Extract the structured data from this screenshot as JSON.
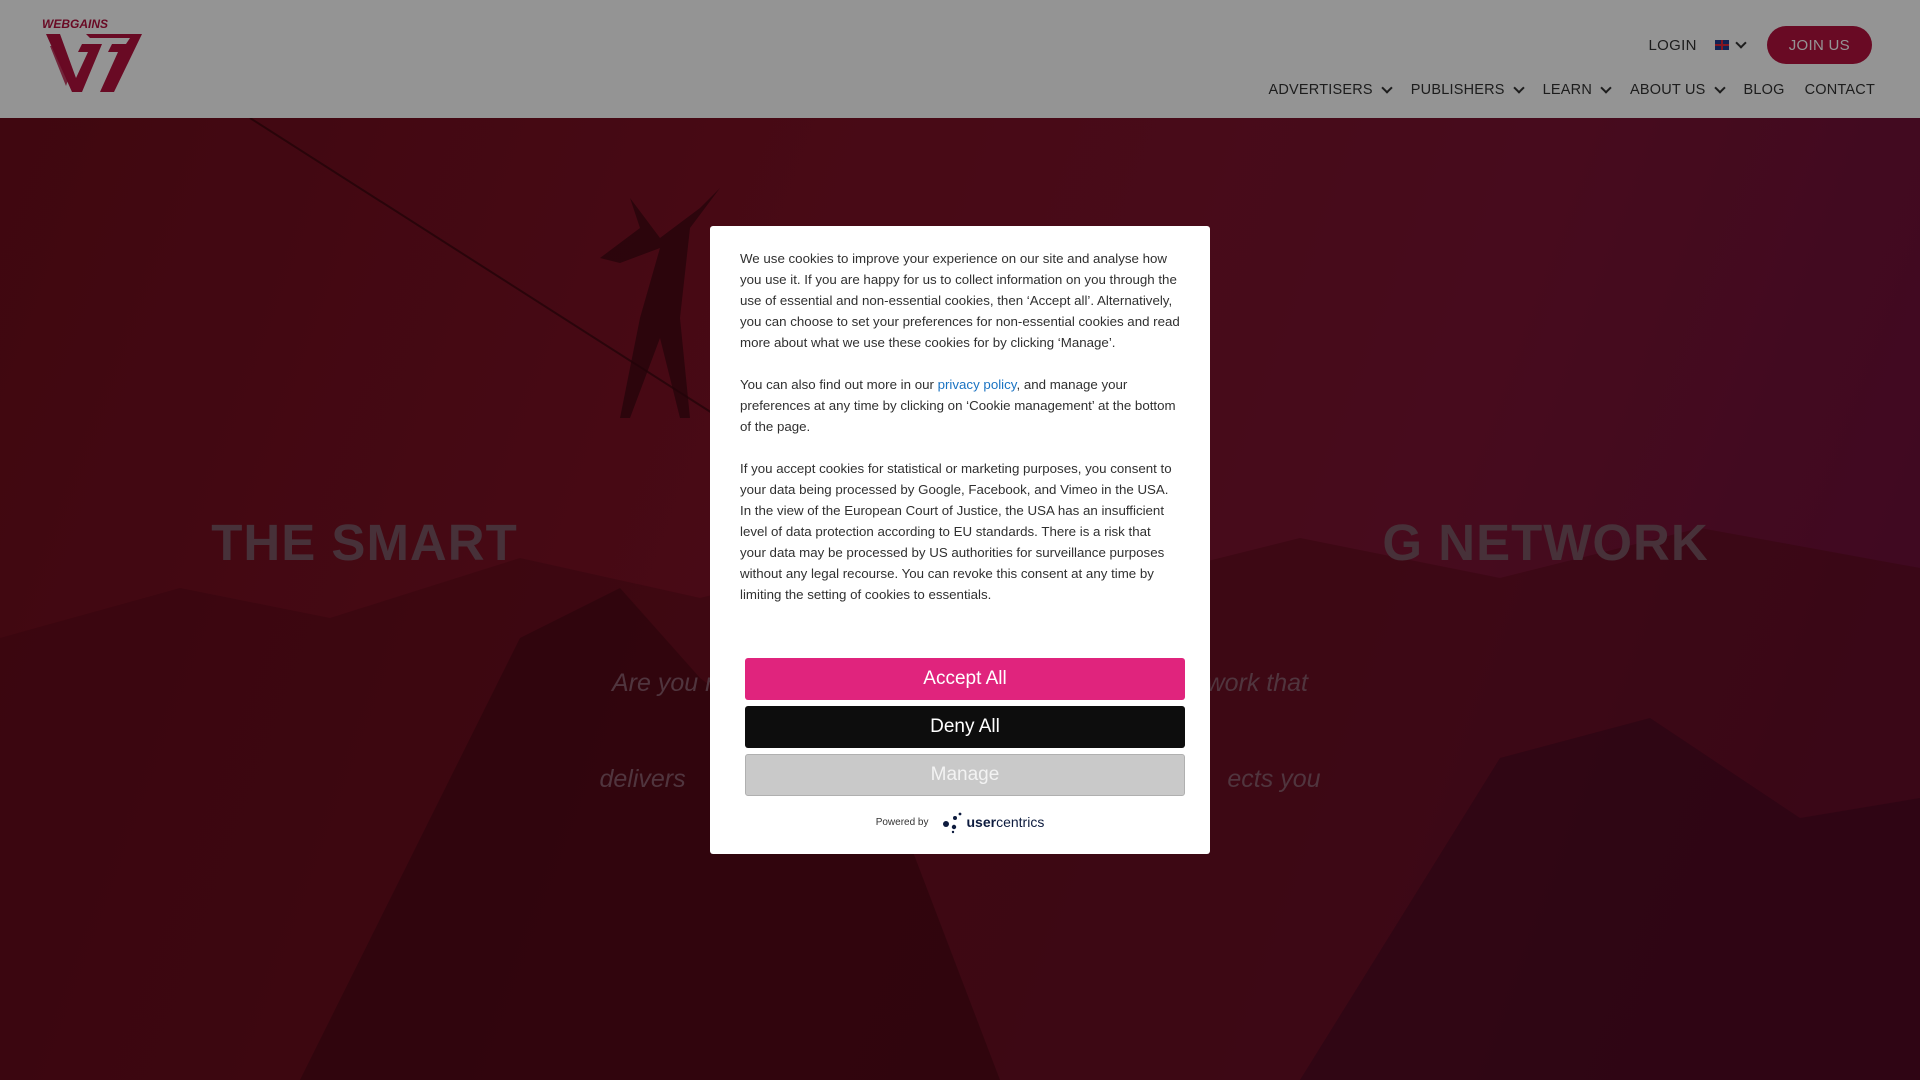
{
  "header": {
    "logo_text": "WEBGAINS",
    "login": "LOGIN",
    "join_button": "JOIN US",
    "nav": [
      {
        "label": "ADVERTISERS",
        "dropdown": true
      },
      {
        "label": "PUBLISHERS",
        "dropdown": true
      },
      {
        "label": "LEARN",
        "dropdown": true
      },
      {
        "label": "ABOUT US",
        "dropdown": true
      },
      {
        "label": "BLOG",
        "dropdown": false
      },
      {
        "label": "CONTACT",
        "dropdown": false
      }
    ]
  },
  "hero": {
    "title": "THE SMART                                                         G NETWORK",
    "subtitle_line1": "Are you r                                                                       work that",
    "subtitle_line2": "delivers                                                                              ects you"
  },
  "consent": {
    "para1": "We use cookies to improve your experience on our site and analyse how you use it. If you are happy for us to collect information on you through the use of essential and non-essential cookies, then ‘Accept all’. Alternatively, you can choose to set your preferences for non-essential cookies and read more about what we use these cookies for by clicking ‘Manage’.",
    "para2_before": "You can also find out more in our ",
    "para2_link": "privacy policy",
    "para2_after": ", and manage your preferences at any time by clicking on ‘Cookie management’ at the bottom of the page.",
    "para3": "If you accept cookies for statistical or marketing purposes, you consent to your data being processed by Google, Facebook, and Vimeo in the USA. In the view of the European Court of Justice, the USA has an insufficient level of data protection according to EU standards. There is a risk that your data may be processed by US authorities for surveillance purposes without any legal recourse. You can revoke this consent at any time by limiting the setting of cookies to essentials.",
    "accept_label": "Accept All",
    "deny_label": "Deny All",
    "manage_label": "Manage",
    "powered_by": "Powered by",
    "brand_a": "user",
    "brand_b": "centrics"
  },
  "colors": {
    "brand": "#b5123f",
    "accept": "#e0247d",
    "deny": "#0d0d0d",
    "manage": "#c9c9c9",
    "link": "#1a73c2"
  }
}
